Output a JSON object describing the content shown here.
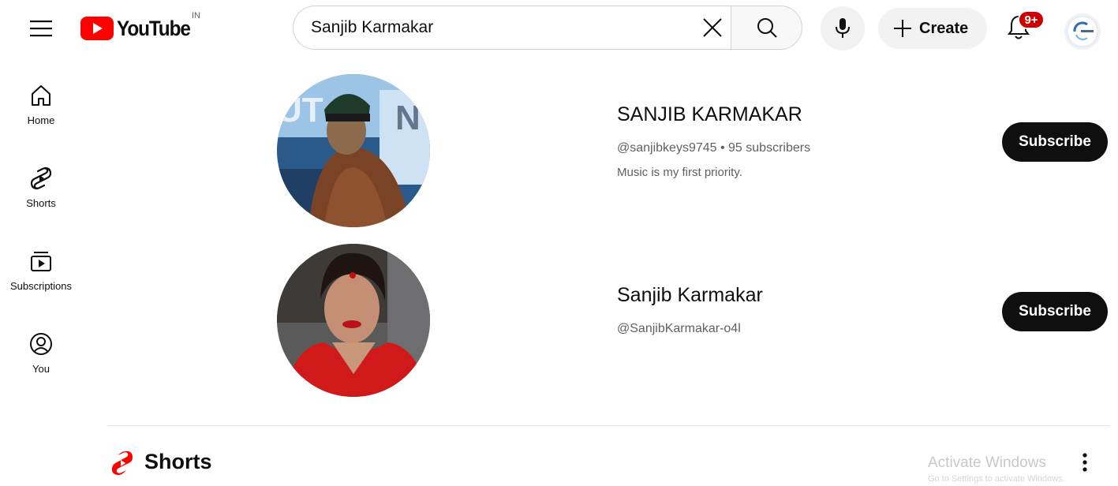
{
  "header": {
    "logo_text": "YouTube",
    "country_code": "IN",
    "search_value": "Sanjib Karmakar",
    "create_label": "Create",
    "notification_count": "9+",
    "brand_color": "#ff0000"
  },
  "sidebar": {
    "items": [
      {
        "label": "Home",
        "icon": "home-icon"
      },
      {
        "label": "Shorts",
        "icon": "shorts-icon"
      },
      {
        "label": "Subscriptions",
        "icon": "subscriptions-icon"
      },
      {
        "label": "You",
        "icon": "you-icon"
      }
    ]
  },
  "results": [
    {
      "name": "SANJIB KARMAKAR",
      "meta": "@sanjibkeys9745 • 95 subscribers",
      "description": "Music is my first priority.",
      "button": "Subscribe"
    },
    {
      "name": "Sanjib Karmakar",
      "meta": "@SanjibKarmakar-o4l",
      "button": "Subscribe"
    }
  ],
  "shorts": {
    "title": "Shorts"
  },
  "watermark": {
    "line1": "Activate Windows",
    "line2": "Go to Settings to activate Windows."
  }
}
